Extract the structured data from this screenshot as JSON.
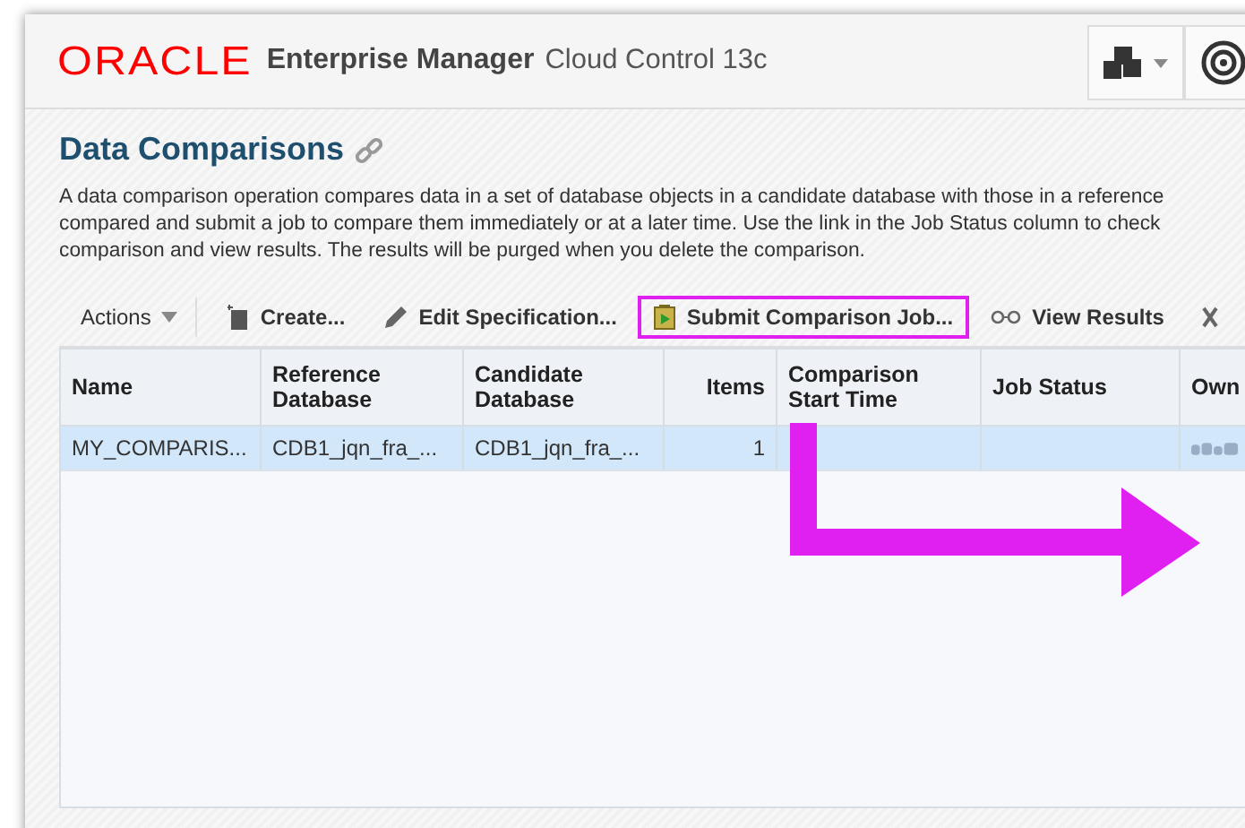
{
  "header": {
    "brand": "ORACLE",
    "product": "Enterprise Manager",
    "edition": "Cloud Control 13c"
  },
  "page": {
    "title": "Data Comparisons",
    "description": [
      "A data comparison operation compares data in a set of database objects in a candidate database with those in a reference",
      "compared and submit a job to compare them immediately or at a later time. Use the link in the Job Status column to check",
      "comparison and view results. The results will be purged when you delete the comparison."
    ]
  },
  "toolbar": [
    {
      "kind": "menu",
      "label": "Actions",
      "highlighted": false
    },
    {
      "kind": "create",
      "label": "Create...",
      "highlighted": false
    },
    {
      "kind": "edit",
      "label": "Edit Specification...",
      "highlighted": false
    },
    {
      "kind": "submit",
      "label": "Submit Comparison Job...",
      "highlighted": true
    },
    {
      "kind": "view",
      "label": "View Results",
      "highlighted": false
    },
    {
      "kind": "delete",
      "highlighted": false
    }
  ],
  "table": {
    "columns": [
      {
        "label": "Name",
        "kind": "text"
      },
      {
        "label": "Reference Database",
        "kind": "text"
      },
      {
        "label": "Candidate Database",
        "kind": "text"
      },
      {
        "label": "Items",
        "kind": "number"
      },
      {
        "label": "Comparison Start Time",
        "kind": "text"
      },
      {
        "label": "Job Status",
        "kind": "text"
      },
      {
        "label": "Own",
        "kind": "text"
      }
    ],
    "rows": [
      {
        "selected": true,
        "cells": [
          "MY_COMPARIS...",
          "CDB1_jqn_fra_...",
          "CDB1_jqn_fra_...",
          "1"
        ],
        "owner": {
          "kind": "blurred"
        }
      }
    ]
  },
  "annotation": {
    "kind": "arrow"
  }
}
